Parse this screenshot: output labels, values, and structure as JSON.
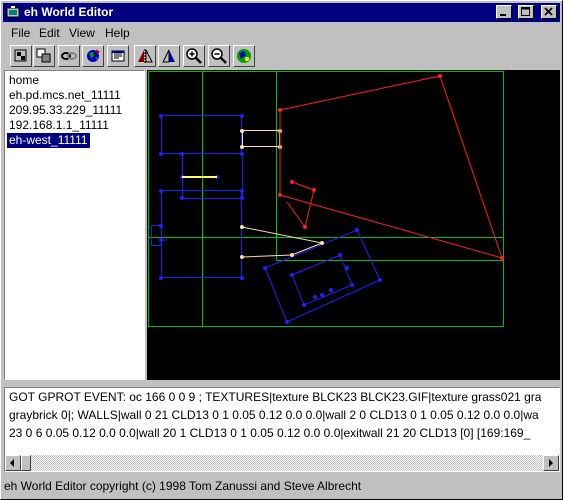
{
  "window": {
    "title": "eh World Editor"
  },
  "menu": [
    "File",
    "Edit",
    "View",
    "Help"
  ],
  "toolbar": [
    {
      "name": "new-icon"
    },
    {
      "name": "rooms-icon"
    },
    {
      "name": "link-icon"
    },
    {
      "name": "globe-icon"
    },
    {
      "name": "properties-icon"
    },
    {
      "name": "flip-horizontal-icon"
    },
    {
      "name": "flip-vertical-icon"
    },
    {
      "name": "zoom-in-icon"
    },
    {
      "name": "zoom-out-icon"
    },
    {
      "name": "world-icon"
    }
  ],
  "hosts": {
    "items": [
      "home",
      "eh.pd.mcs.net_11111",
      "209.95.33.229_11111",
      "192.168.1.1_11111",
      "eh-west_11111"
    ],
    "selected_index": 4
  },
  "log": {
    "lines": [
      "GOT GPROT EVENT: oc 166 0 0 9 ; TEXTURES|texture BLCK23 BLCK23.GIF|texture grass021 gra",
      "graybrick 0|; WALLS|wall 0 21 CLD13 0 1 0.05 0.12 0.0 0.0|wall 2 0 CLD13 0 1 0.05 0.12 0.0 0.0|wa",
      "23 0 6 0.05 0.12 0.0 0.0|wall 20 1 CLD13 0 1 0.05 0.12 0.0 0.0|exitwall 21 20 CLD13 [0] [169:169_"
    ]
  },
  "status": "eh World Editor copyright (c) 1998 Tom Zanussi and Steve Albrecht",
  "colors": {
    "title_bar": "#000080",
    "map_bg": "#000000",
    "grid": "#00a000",
    "room_blue": "#2020ff",
    "room_red": "#ff2020",
    "selection": "#ffff60"
  }
}
